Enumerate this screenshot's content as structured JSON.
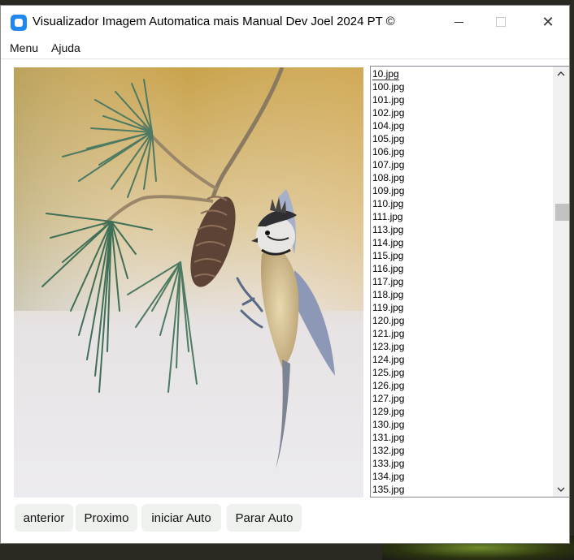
{
  "window": {
    "title": "Visualizador Imagem Automatica mais Manual Dev Joel 2024 PT ©",
    "minimize_glyph": "—",
    "close_glyph": "✕"
  },
  "menubar": {
    "items": [
      {
        "label": "Menu"
      },
      {
        "label": "Ajuda"
      }
    ]
  },
  "image_viewer": {
    "icon": "bird-photo"
  },
  "file_list": {
    "selected": "10.jpg",
    "items": [
      "10.jpg",
      "100.jpg",
      "101.jpg",
      "102.jpg",
      "104.jpg",
      "105.jpg",
      "106.jpg",
      "107.jpg",
      "108.jpg",
      "109.jpg",
      "110.jpg",
      "111.jpg",
      "113.jpg",
      "114.jpg",
      "115.jpg",
      "116.jpg",
      "117.jpg",
      "118.jpg",
      "119.jpg",
      "120.jpg",
      "121.jpg",
      "123.jpg",
      "124.jpg",
      "125.jpg",
      "126.jpg",
      "127.jpg",
      "129.jpg",
      "130.jpg",
      "131.jpg",
      "132.jpg",
      "133.jpg",
      "134.jpg",
      "135.jpg"
    ]
  },
  "controls": {
    "prev_label": "anterior",
    "next_label": "Proximo",
    "start_label": "iniciar Auto",
    "stop_label": "Parar Auto"
  }
}
